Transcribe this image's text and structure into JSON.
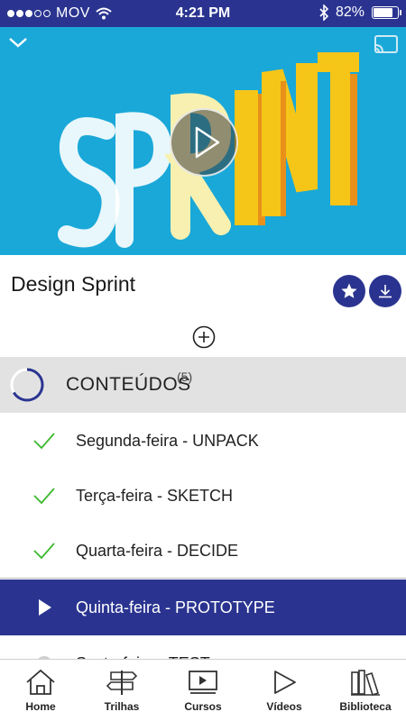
{
  "status_bar": {
    "carrier": "MOV",
    "time": "4:21 PM",
    "battery": "82%",
    "battery_level": 0.82,
    "signal_dots": 5,
    "signal_filled": 3
  },
  "video": {
    "art_text": "SPRINT",
    "collapse_icon": "chevron-down-icon",
    "cast_icon": "cast-icon",
    "play_icon": "play-icon"
  },
  "course": {
    "title": "Design Sprint",
    "favorite_icon": "star-icon",
    "download_icon": "download-icon",
    "add_icon": "plus-circle-icon"
  },
  "contents": {
    "label": "CONTEÚDOS",
    "count": "(5)",
    "items": [
      {
        "label": "Segunda-feira - UNPACK",
        "state": "done"
      },
      {
        "label": "Terça-feira - SKETCH",
        "state": "done"
      },
      {
        "label": "Quarta-feira - DECIDE",
        "state": "done"
      },
      {
        "label": "Quinta-feira - PROTOTYPE",
        "state": "playing"
      },
      {
        "label": "Sexta-feira - TEST",
        "state": "pending"
      }
    ]
  },
  "bottom_nav": {
    "items": [
      {
        "label": "Home",
        "icon": "home-icon"
      },
      {
        "label": "Trilhas",
        "icon": "signpost-icon"
      },
      {
        "label": "Cursos",
        "icon": "course-icon"
      },
      {
        "label": "Vídeos",
        "icon": "video-icon"
      },
      {
        "label": "Biblioteca",
        "icon": "library-icon"
      }
    ]
  },
  "colors": {
    "primary": "#2a3490",
    "video_bg": "#1aa8d8",
    "check_green": "#3cba2e",
    "art_white": "#ffffff",
    "art_yellow": "#f5c518",
    "art_orange": "#e8901a"
  }
}
